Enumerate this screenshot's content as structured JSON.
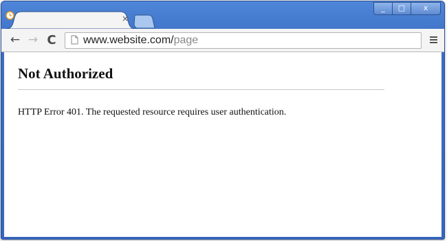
{
  "window": {
    "controls": {
      "minimize": "_",
      "maximize": "□",
      "close": "x"
    }
  },
  "tab": {
    "title": "",
    "close_label": "×"
  },
  "toolbar": {
    "back_label": "←",
    "forward_label": "→",
    "reload_label": "C",
    "url_host": "www.website.com/",
    "url_path": "page"
  },
  "page": {
    "heading": "Not Authorized",
    "message": "HTTP Error 401. The requested resource requires user authentication."
  },
  "colors": {
    "frame": "#3b6fc4",
    "toolbar": "#f4f4f4",
    "content_bg": "#ffffff"
  }
}
